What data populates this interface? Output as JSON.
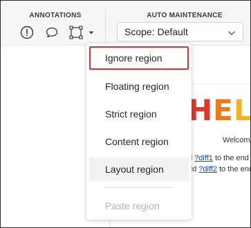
{
  "toolbar": {
    "annotations_title": "ANNOTATIONS",
    "auto_maintenance_title": "AUTO MAINTENANCE",
    "scope_select": {
      "value": "Scope: Default"
    },
    "icons": [
      "alert-circle-icon",
      "comment-icon",
      "region-select-icon",
      "caret-down-icon",
      "chevron-down-icon"
    ]
  },
  "menu": {
    "items": [
      {
        "label": "Ignore region",
        "state": "highlighted"
      },
      {
        "label": "Floating region"
      },
      {
        "label": "Strict region"
      },
      {
        "label": "Content region"
      },
      {
        "label": "Layout region",
        "state": "hover"
      },
      {
        "label": "Paste region",
        "state": "disabled"
      }
    ]
  },
  "preview": {
    "heading_fragment": "HELL",
    "heading_colors": [
      "#e8332a",
      "#f07a1a",
      "#f5b21b",
      "#f5c21b"
    ],
    "welcome_fragment": "Welcom",
    "line1": {
      "prefix": "d ",
      "link": "?diff1",
      "suffix": " to the end"
    },
    "line2": {
      "prefix": "dd ",
      "link": "?diff2",
      "suffix": " to the end"
    }
  },
  "colors": {
    "highlight_border": "#d9322b",
    "link": "#1a46c8",
    "toolbar_bg": "#f6f6f7"
  }
}
